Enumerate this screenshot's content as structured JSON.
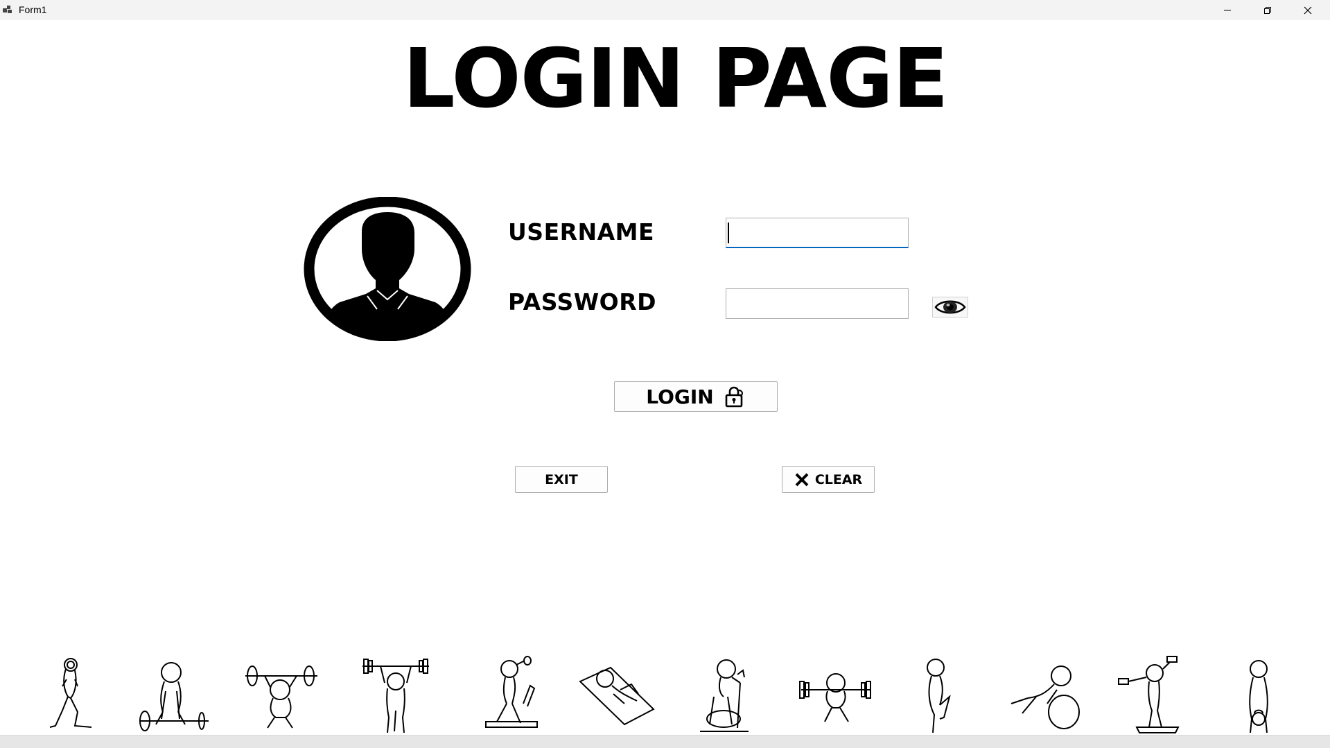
{
  "window": {
    "title": "Form1",
    "app_icon": "form-icon",
    "controls": [
      "minimize-icon",
      "restore-icon",
      "close-icon"
    ]
  },
  "page": {
    "heading": "LOGIN PAGE"
  },
  "form": {
    "avatar_icon": "user-silhouette-icon",
    "username_label": "USERNAME",
    "username_value": "",
    "password_label": "PASSWORD",
    "password_value": "",
    "show_password_icon": "eye-icon"
  },
  "buttons": {
    "login_label": "LOGIN",
    "login_icon": "lock-icon",
    "exit_label": "EXIT",
    "clear_label": "CLEAR",
    "clear_icon": "x-icon"
  },
  "footer": {
    "figures": [
      "lunge-figure-icon",
      "deadlift-figure-icon",
      "squat-overhead-figure-icon",
      "overhead-press-figure-icon",
      "treadmill-figure-icon",
      "mat-situp-figure-icon",
      "exercise-bike-figure-icon",
      "barbell-squat-figure-icon",
      "stretch-figure-icon",
      "stability-ball-figure-icon",
      "dumbbell-step-figure-icon",
      "kettlebell-figure-icon"
    ]
  },
  "colors": {
    "titlebar": "#f3f3f3",
    "focus_border": "#0067c0",
    "text": "#000000"
  }
}
